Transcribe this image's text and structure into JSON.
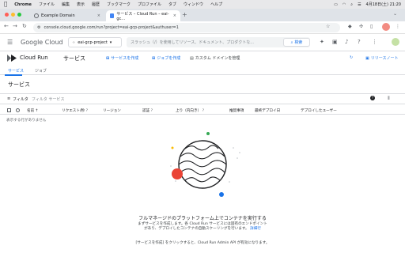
{
  "menubar": {
    "app": "Chrome",
    "items": [
      "ファイル",
      "編集",
      "表示",
      "履歴",
      "ブックマーク",
      "プロファイル",
      "タブ",
      "ウィンドウ",
      "ヘルプ"
    ],
    "datetime": "4月18日(土) 21:20"
  },
  "tabs": [
    {
      "title": "Example Domain",
      "icon": "globe-icon"
    },
    {
      "title": "サービス – Cloud Run – eai-gc...",
      "icon": "cloud-run-icon"
    }
  ],
  "address": {
    "url": "console.cloud.google.com/run?project=eai-gcp-project&authuser=1"
  },
  "console": {
    "logo_google": "Google",
    "logo_cloud": "Cloud",
    "project": "eai-gcp-project",
    "search_placeholder": "スラッシュ（/）を使用してリソース、ドキュメント、プロダクトな...",
    "search_button": "検索"
  },
  "page": {
    "product": "Cloud Run",
    "title": "サービス",
    "actions": {
      "create_service": "サービスを作成",
      "create_job": "ジョブを作成",
      "manage_domains": "カスタム ドメインを管理",
      "release_notes": "リリースノート"
    },
    "subtabs": [
      "サービス",
      "ジョブ"
    ],
    "section_title": "サービス",
    "filter_label": "フィルタ",
    "filter_placeholder": "フィルタ サービス"
  },
  "table": {
    "columns": {
      "name": "名前",
      "requests": "リクエスト/秒",
      "region": "リージョン",
      "auth": "認証",
      "ingress": "上り（内向き）",
      "recommendations": "推奨事項",
      "last_deployed": "最終デプロイ日",
      "deployed_by": "デプロイしたユーザー"
    },
    "empty_message": "表示する行がありません"
  },
  "empty_state": {
    "title": "フルマネージドのプラットフォーム上でコンテナを実行する",
    "desc_line1": "まずサービスを作成します。各 Cloud Run サービスには固有のエンドポイント",
    "desc_line2": "があり、デプロイしたコンテナの自動スケーリングを行います。",
    "desc_link": "詳細行",
    "footer": "[サービスを作成] をクリックすると、Cloud Run Admin API が有効になります。"
  },
  "colors": {
    "accent": "#1a73e8",
    "traffic_red": "#ff5f57",
    "traffic_yellow": "#febc2e",
    "traffic_green": "#28c840"
  }
}
